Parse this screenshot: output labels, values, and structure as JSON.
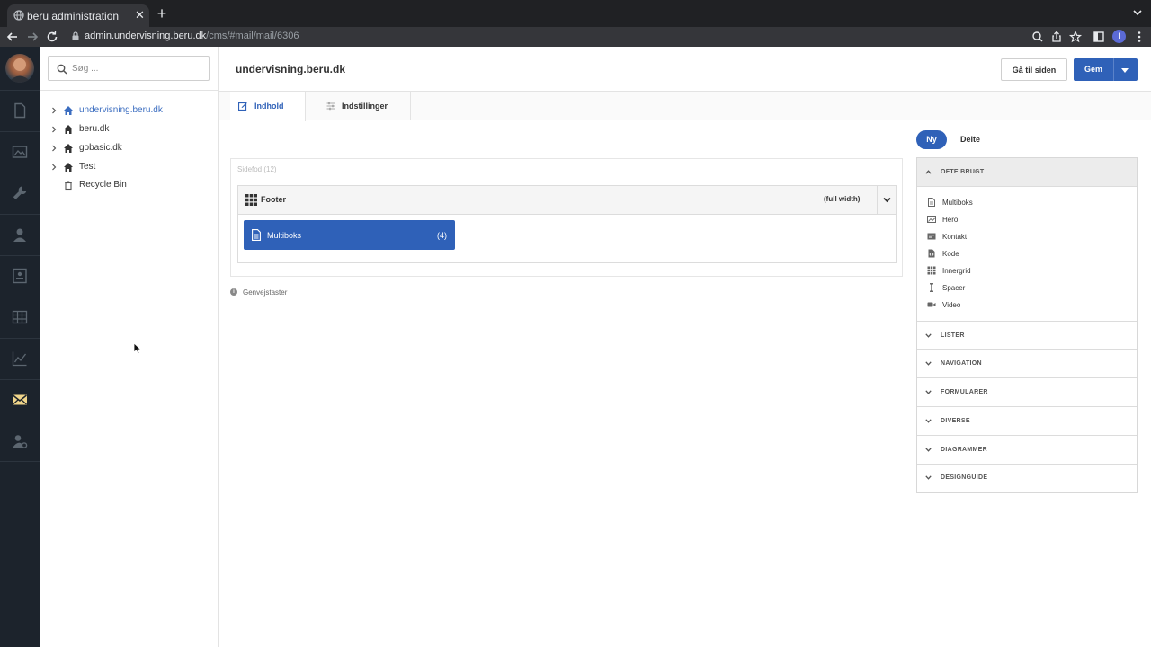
{
  "browser": {
    "tab_title": "beru administration",
    "url_host": "admin.undervisning.beru.dk",
    "url_path": "/cms/#mail/mail/6306",
    "profile_initial": "I"
  },
  "search": {
    "placeholder": "Søg ..."
  },
  "tree": [
    {
      "label": "undervisning.beru.dk",
      "icon": "home-icon",
      "active": true
    },
    {
      "label": "beru.dk",
      "icon": "home-icon"
    },
    {
      "label": "gobasic.dk",
      "icon": "home-icon"
    },
    {
      "label": "Test",
      "icon": "home-icon"
    },
    {
      "label": "Recycle Bin",
      "icon": "trash-icon"
    }
  ],
  "header": {
    "site_name": "undervisning.beru.dk",
    "goto_label": "Gå til siden",
    "save_label": "Gem"
  },
  "tabs": [
    {
      "label": "Indhold",
      "active": true
    },
    {
      "label": "Indstillinger"
    }
  ],
  "content": {
    "section_title": "Sidefod (12)",
    "row_name": "Footer",
    "row_width": "(full width)",
    "module_name": "Multiboks",
    "module_count": "(4)",
    "shortcuts_label": "Genvejstaster"
  },
  "panel": {
    "pill_new": "Ny",
    "pill_shared": "Delte",
    "open_group": "OFTE BRUGT",
    "items": [
      {
        "label": "Multiboks",
        "icon": "document-icon"
      },
      {
        "label": "Hero",
        "icon": "image-icon"
      },
      {
        "label": "Kontakt",
        "icon": "contact-card-icon"
      },
      {
        "label": "Kode",
        "icon": "code-file-icon"
      },
      {
        "label": "Innergrid",
        "icon": "grid-icon"
      },
      {
        "label": "Spacer",
        "icon": "spacer-icon"
      },
      {
        "label": "Video",
        "icon": "video-icon"
      }
    ],
    "groups": [
      "LISTER",
      "NAVIGATION",
      "FORMULARER",
      "DIVERSE",
      "DIAGRAMMER",
      "DESIGNGUIDE"
    ]
  },
  "colors": {
    "accent": "#2f61b8",
    "rail": "#1c232c",
    "active_rail_icon": "#f0d58a"
  }
}
